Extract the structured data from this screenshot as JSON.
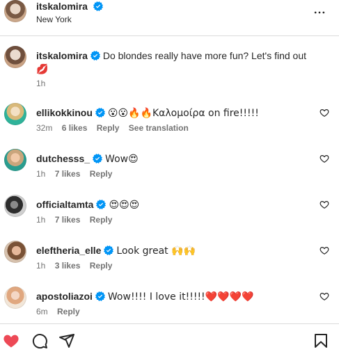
{
  "header": {
    "username": "itskalomira",
    "location": "New York",
    "more_icon": "more-horizontal-icon"
  },
  "caption": {
    "username": "itskalomira",
    "text": "Do blondes really have more fun? Let's find out",
    "emoji": "💋",
    "time": "1h"
  },
  "comments": [
    {
      "username": "ellikokkinou",
      "text": "😮😮🔥🔥Καλομοίρα on fire!!!!!",
      "time": "32m",
      "likes": "6 likes",
      "reply": "Reply",
      "translate": "See translation"
    },
    {
      "username": "dutchesss_",
      "text": "Wow😍",
      "time": "1h",
      "likes": "7 likes",
      "reply": "Reply"
    },
    {
      "username": "officialtamta",
      "text": "😍😍😍",
      "time": "1h",
      "likes": "7 likes",
      "reply": "Reply"
    },
    {
      "username": "eleftheria_elle",
      "text": "Look great 🙌🙌",
      "time": "1h",
      "likes": "3 likes",
      "reply": "Reply"
    },
    {
      "username": "apostoliazoi",
      "text": "Wow!!!! I love it!!!!!❤️❤️❤️❤️",
      "time": "6m",
      "reply": "Reply"
    }
  ],
  "colors": {
    "like_red": "#ed4956",
    "verified_blue": "#0095f6",
    "muted": "#737373"
  },
  "icons": {
    "like": "heart-filled-icon",
    "comment": "comment-icon",
    "share": "paper-plane-icon",
    "save": "bookmark-icon"
  }
}
